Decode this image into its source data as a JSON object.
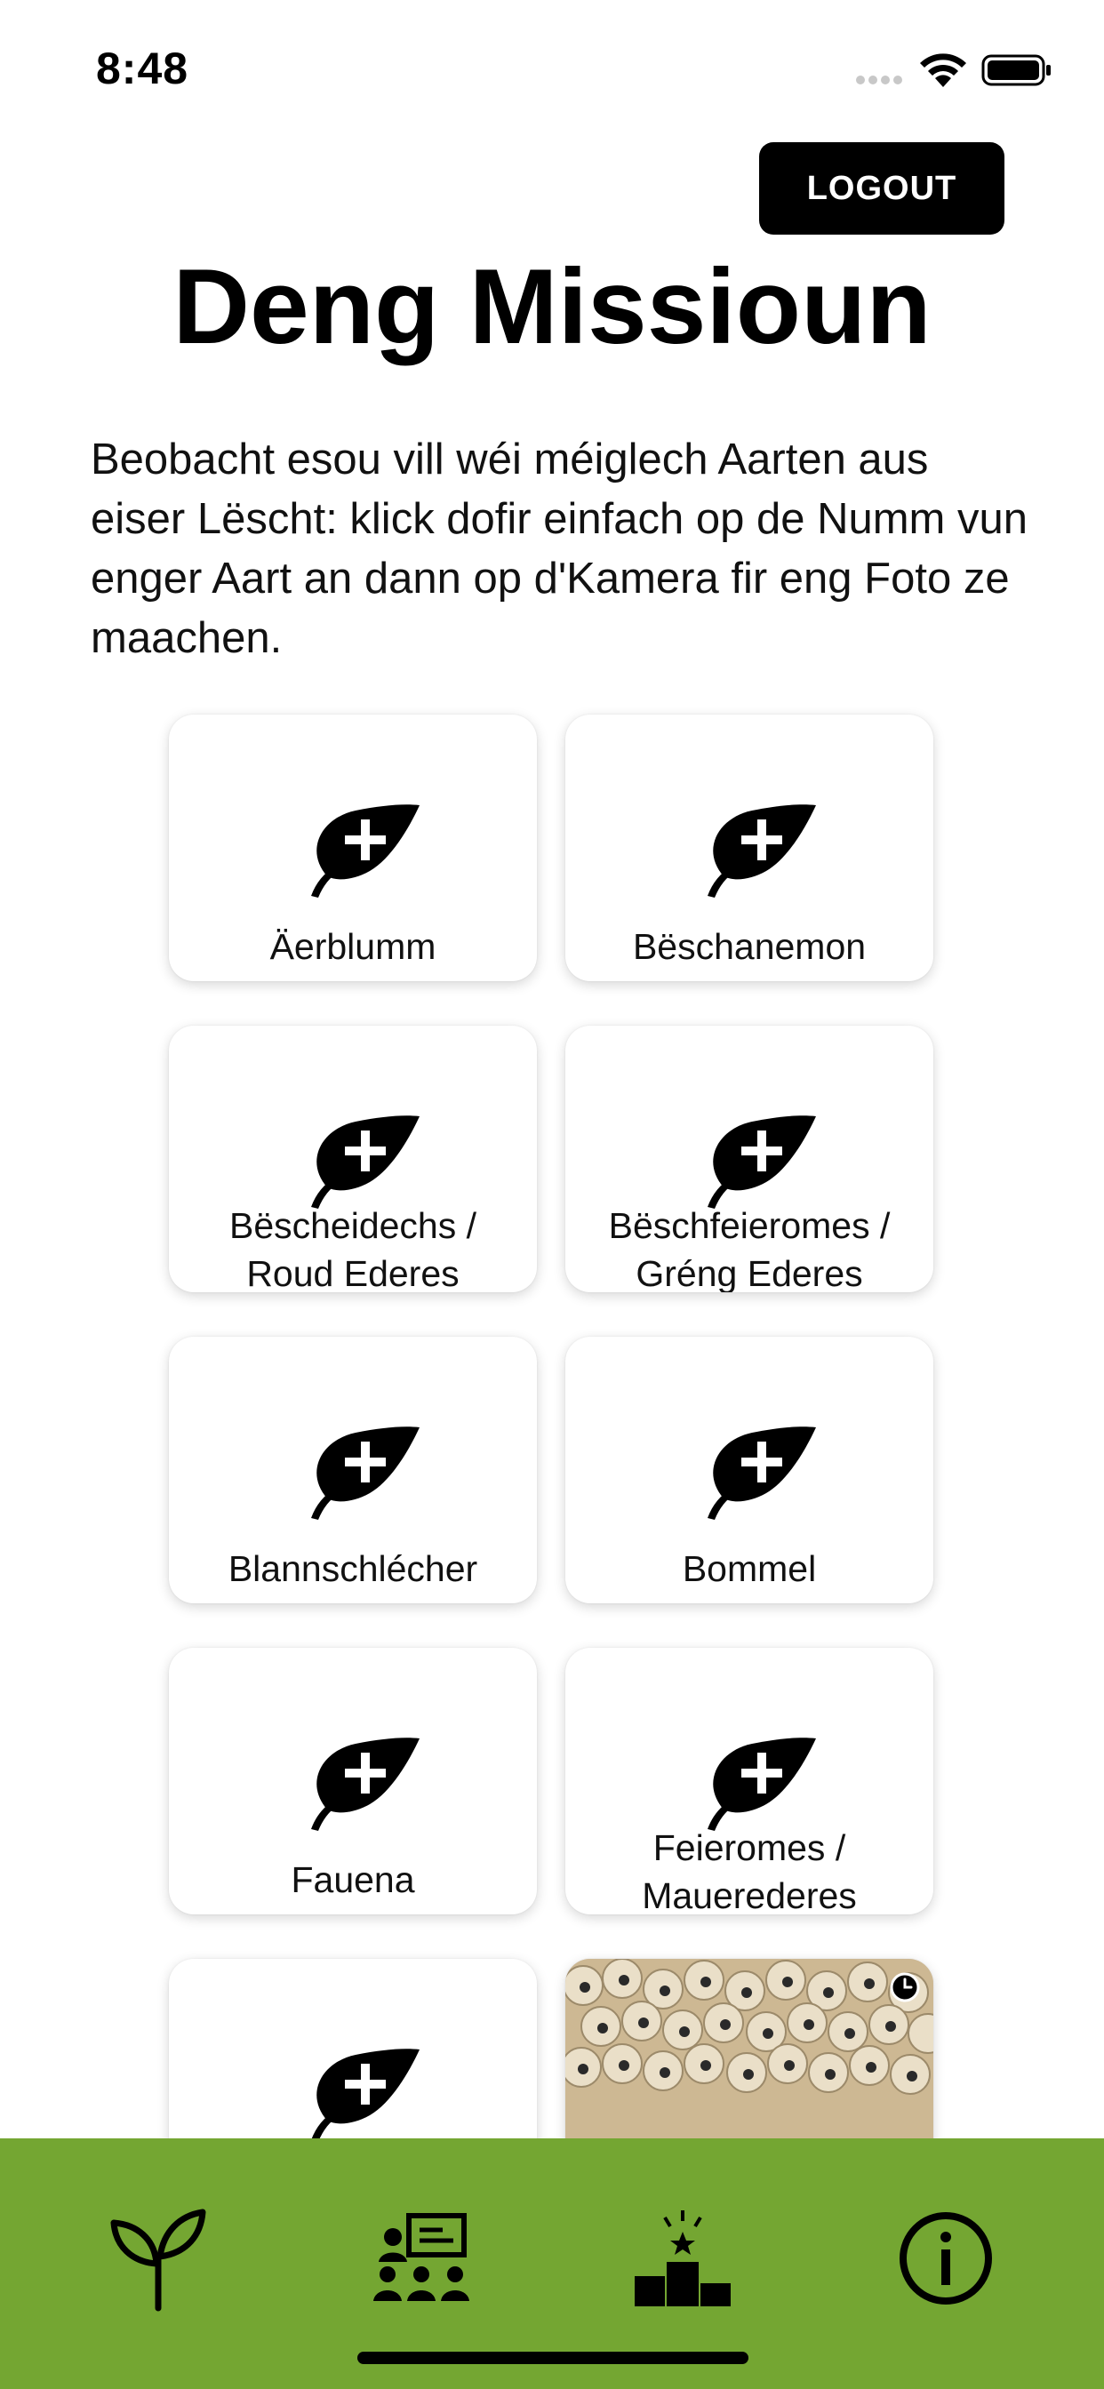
{
  "status_bar": {
    "time": "8:48"
  },
  "header": {
    "logout_label": "LOGOUT",
    "title": "Deng Missioun"
  },
  "intro": "Beobacht esou vill wéi méiglech Aarten aus eiser Lëscht: klick dofir einfach op de Numm vun enger Aart an dann op d'Kamera fir eng Foto ze maachen.",
  "species": [
    {
      "name": "Äerblumm"
    },
    {
      "name": "Bëschanemon"
    },
    {
      "line1": "Bëscheidechs /",
      "line2": "Roud Ederes"
    },
    {
      "line1": "Bëschfeieromes /",
      "line2": "Gréng Ederes"
    },
    {
      "name": "Blannschlécher"
    },
    {
      "name": "Bommel"
    },
    {
      "name": "Fauena"
    },
    {
      "line1": "Feieromes /",
      "line2": "Mauerederes"
    }
  ],
  "icons": {
    "species_icon": "leaf-plus-icon",
    "pending_badge": "clock-icon",
    "nav": [
      "plant-sprout-icon",
      "classroom-icon",
      "ranking-podium-icon",
      "info-icon"
    ]
  },
  "colors": {
    "nav_background": "#74a632",
    "button": "#000000",
    "text": "#111111"
  }
}
